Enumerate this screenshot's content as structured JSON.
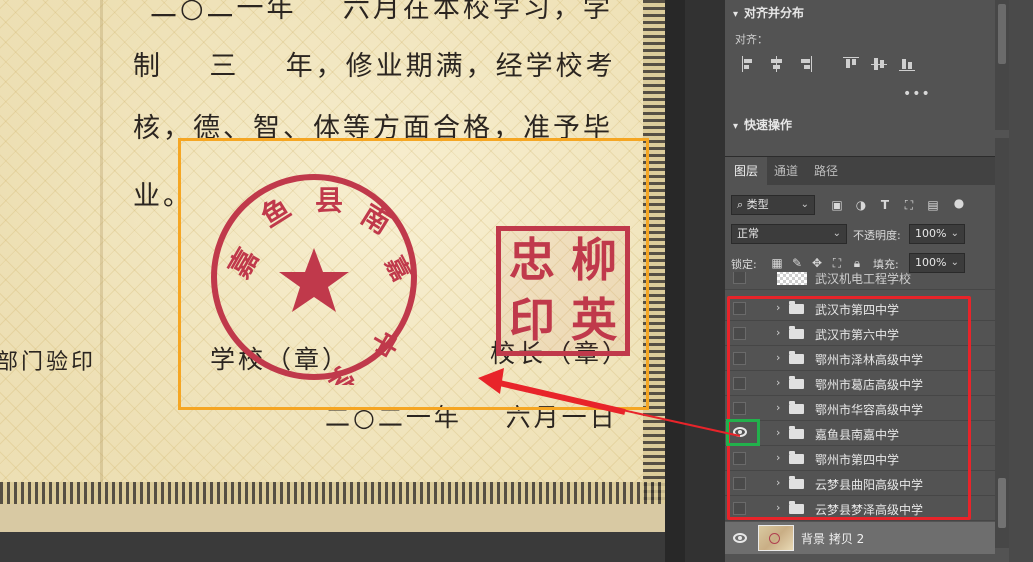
{
  "document": {
    "line_top": "二○二一年    六月在本校学习，学",
    "line1": "制    三    年，修业期满，经学校考",
    "line2": "核，德、智、体等方面合格，准予毕",
    "line3": "业。",
    "side_label": "部门验印",
    "school_label": "学校（章）",
    "principal_label": "校长（章）",
    "date_line": "二○二一年    六月一日",
    "school_seal": {
      "arc_text": "嘉鱼县南嘉中学",
      "chars": [
        "嘉",
        "鱼",
        "县",
        "南",
        "嘉",
        "中",
        "学"
      ],
      "star": "★"
    },
    "personal_seal": {
      "chars": [
        "忠",
        "柳",
        "印",
        "英"
      ]
    }
  },
  "align_panel": {
    "title": "对齐并分布",
    "align_label": "对齐：",
    "more": "•••",
    "quick_actions_title": "快速操作"
  },
  "layers_panel": {
    "tabs": [
      {
        "label": "图层",
        "active": true
      },
      {
        "label": "通道",
        "active": false
      },
      {
        "label": "路径",
        "active": false
      }
    ],
    "filter_kind": "类型",
    "blend_mode": "正常",
    "opacity_label": "不透明度:",
    "opacity_value": "100%",
    "lock_label": "锁定:",
    "fill_label": "填充:",
    "fill_value": "100%",
    "partial_top_layer": "武汉机电工程学校",
    "layers": [
      {
        "name": "武汉市第四中学",
        "visible": false
      },
      {
        "name": "武汉市第六中学",
        "visible": false
      },
      {
        "name": "鄂州市泽林高级中学",
        "visible": false
      },
      {
        "name": "鄂州市葛店高级中学",
        "visible": false
      },
      {
        "name": "鄂州市华容高级中学",
        "visible": false
      },
      {
        "name": "嘉鱼县南嘉中学",
        "visible": true
      },
      {
        "name": "鄂州市第四中学",
        "visible": false
      },
      {
        "name": "云梦县曲阳高级中学",
        "visible": false
      },
      {
        "name": "云梦县梦泽高级中学",
        "visible": false
      }
    ],
    "background_layer": "背景 拷贝 2"
  },
  "colors": {
    "highlight_orange": "#f5a623",
    "annotation_red": "#e8242a",
    "eye_green": "#22b14c",
    "seal_red": "#c0394b"
  }
}
